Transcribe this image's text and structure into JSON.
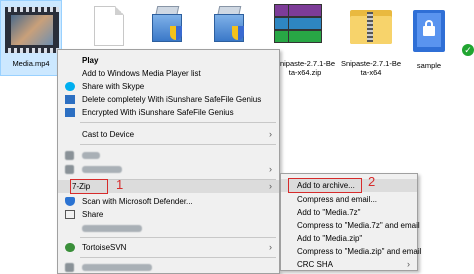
{
  "desktop": {
    "files": [
      {
        "name": "Media.mp4",
        "icon": "video-file-icon"
      },
      {
        "name": "",
        "icon": "blank-document-icon"
      },
      {
        "name": "",
        "icon": "installer-icon"
      },
      {
        "name": "",
        "icon": "installer-icon"
      },
      {
        "name": "",
        "icon": "winrar-archive-icon"
      },
      {
        "name": "Snipaste-2.7.1-Be\nta-x64.zip",
        "line1": "Snipaste-2.7.1-Be",
        "line2": "ta-x64.zip",
        "icon": "winrar-archive-icon"
      },
      {
        "name": "Snipaste-2.7.1-Be\nta-x64",
        "line1": "Snipaste-2.7.1-Be",
        "line2": "ta-x64",
        "icon": "zip-folder-icon"
      },
      {
        "name": "sample",
        "icon": "locked-document-icon"
      }
    ]
  },
  "context_menu": {
    "items": [
      {
        "label": "Play",
        "bold": true
      },
      {
        "label": "Add to Windows Media Player list"
      },
      {
        "label": "Share with Skype",
        "icon": "skype-icon"
      },
      {
        "label": "Delete completely With iSunshare SafeFile Genius",
        "icon": "isunshare-icon"
      },
      {
        "label": "Encrypted With iSunshare SafeFile Genius",
        "icon": "isunshare-icon"
      },
      {
        "label": "Cast to Device",
        "has_submenu": true
      },
      {
        "label": "7-Zip",
        "has_submenu": true,
        "highlighted": true
      },
      {
        "label": "Scan with Microsoft Defender...",
        "icon": "defender-icon"
      },
      {
        "label": "Share",
        "icon": "share-icon"
      },
      {
        "label": "TortoiseSVN",
        "icon": "tortoisesvn-icon",
        "has_submenu": true
      }
    ],
    "annotation": "1"
  },
  "submenu": {
    "items": [
      {
        "label": "Add to archive...",
        "highlighted": true
      },
      {
        "label": "Compress and email..."
      },
      {
        "label": "Add to \"Media.7z\""
      },
      {
        "label": "Compress to \"Media.7z\" and email"
      },
      {
        "label": "Add to \"Media.zip\""
      },
      {
        "label": "Compress to \"Media.zip\" and email"
      },
      {
        "label": "CRC SHA",
        "has_submenu": true
      }
    ],
    "annotation": "2"
  },
  "colors": {
    "highlight_box": "#d62b2b",
    "menu_bg": "#f0f0f0",
    "selection": "#cce8ff"
  }
}
